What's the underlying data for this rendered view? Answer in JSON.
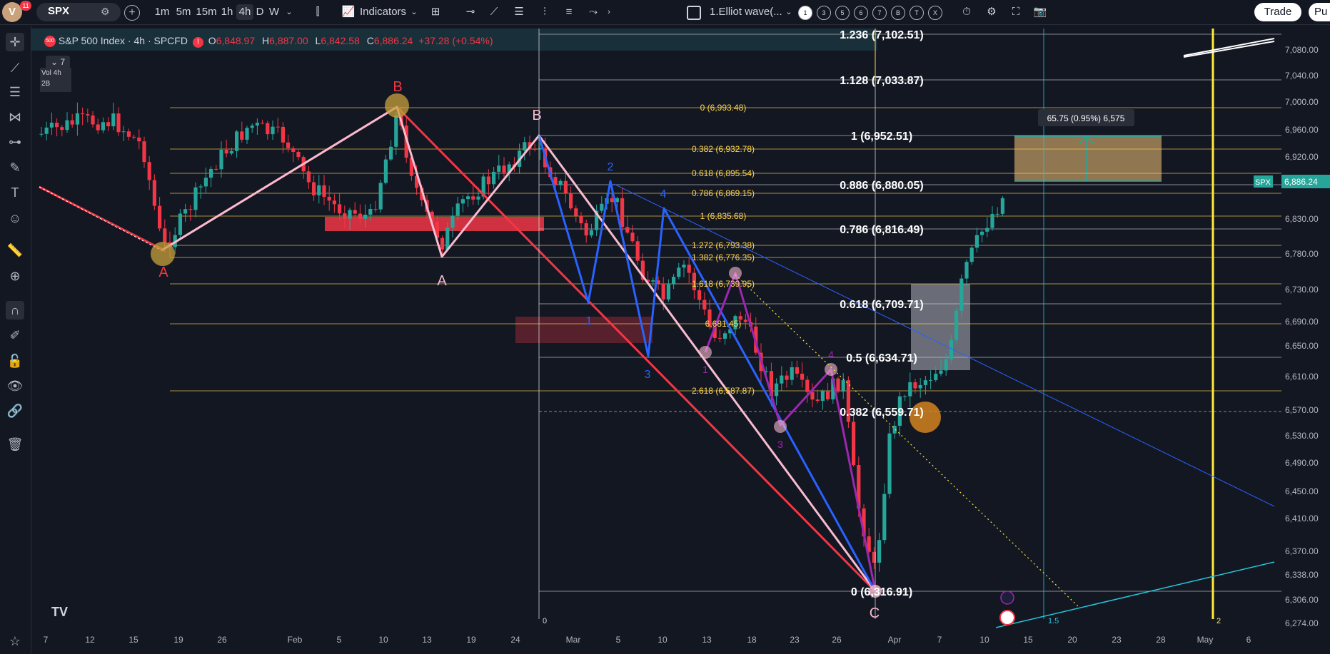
{
  "topbar": {
    "avatar_letter": "V",
    "notif_count": "11",
    "symbol": "SPX",
    "intervals": [
      "1m",
      "5m",
      "15m",
      "1h",
      "4h",
      "D",
      "W"
    ],
    "active_interval": "4h",
    "indicators_label": "Indicators",
    "layout_name": "1.Elliot wave(...",
    "wave_degrees": [
      "1",
      "3",
      "5",
      "6",
      "7",
      "B",
      "T",
      "X"
    ],
    "trade_label": "Trade",
    "publish_label": "Pu"
  },
  "header": {
    "badge": "500",
    "title": "S&P 500 Index · 4h · SPCFD",
    "open_label": "O",
    "open": "6,848.97",
    "high_label": "H",
    "high": "6,887.00",
    "low_label": "L",
    "low": "6,842.58",
    "close_label": "C",
    "close": "6,886.24",
    "change": "+37.28 (+0.54%)",
    "collapsed_count": "7",
    "overlay_lines": [
      "Vol 4h",
      "2B"
    ]
  },
  "price_axis": {
    "ticks": [
      "7,080.00",
      "7,040.00",
      "7,000.00",
      "6,960.00",
      "6,920.00",
      "6,830.00",
      "6,780.00",
      "6,730.00",
      "6,690.00",
      "6,650.00",
      "6,610.00",
      "6,570.00",
      "6,530.00",
      "6,490.00",
      "6,450.00",
      "6,410.00",
      "6,370.00",
      "6,338.00",
      "6,306.00",
      "6,274.00"
    ],
    "current_symbol": "SPX",
    "current_price": "6,886.24"
  },
  "time_axis": {
    "ticks": [
      "7",
      "12",
      "15",
      "19",
      "26",
      "Feb",
      "5",
      "10",
      "13",
      "19",
      "24",
      "Mar",
      "5",
      "10",
      "13",
      "18",
      "23",
      "26",
      "Apr",
      "7",
      "10",
      "15",
      "20",
      "23",
      "28",
      "May",
      "6"
    ]
  },
  "fib_left": [
    "0 (6,993.48)",
    "0.382 (6,932.78)",
    "0.618 (6,895.54)",
    "0.786 (6,869.15)",
    "1 (6,835.68)",
    "1.272 (6,793.38)",
    "1.382 (6,776.35)",
    "1.618 (6,739.95)",
    "6,681.45)",
    "2.618 (6,587.87)"
  ],
  "fib_right": [
    "1.236 (7,102.51)",
    "1.128 (7,033.87)",
    "1 (6,952.51)",
    "0.886 (6,880.05)",
    "0.786 (6,816.49)",
    "0.618 (6,709.71)",
    "0.5 (6,634.71)",
    "0.382 (6,559.71)",
    "0 (6,316.91)"
  ],
  "wave_labels": {
    "red": [
      "A",
      "B"
    ],
    "pink": [
      "A",
      "B",
      "C"
    ],
    "blue": [
      "1",
      "2",
      "3",
      "4"
    ],
    "purple": [
      "1",
      "3",
      "4"
    ]
  },
  "measure_label": "65.75 (0.95%) 6,575",
  "vline_labels": [
    "0",
    "1.5",
    "2"
  ],
  "colors": {
    "up": "#26a69a",
    "down": "#f23645",
    "fib": "#ffd54f",
    "background": "#131722",
    "accent": "#2962ff"
  },
  "leftbar_icons": [
    "crosshair-icon",
    "trendline-icon",
    "fib-icon",
    "pattern-icon",
    "forecast-icon",
    "brush-icon",
    "text-icon",
    "emoji-icon",
    "ruler-icon",
    "zoom-icon",
    "magnet-icon",
    "pencil-lock-icon",
    "lock-icon",
    "eye-icon",
    "link-icon",
    "trash-icon"
  ]
}
